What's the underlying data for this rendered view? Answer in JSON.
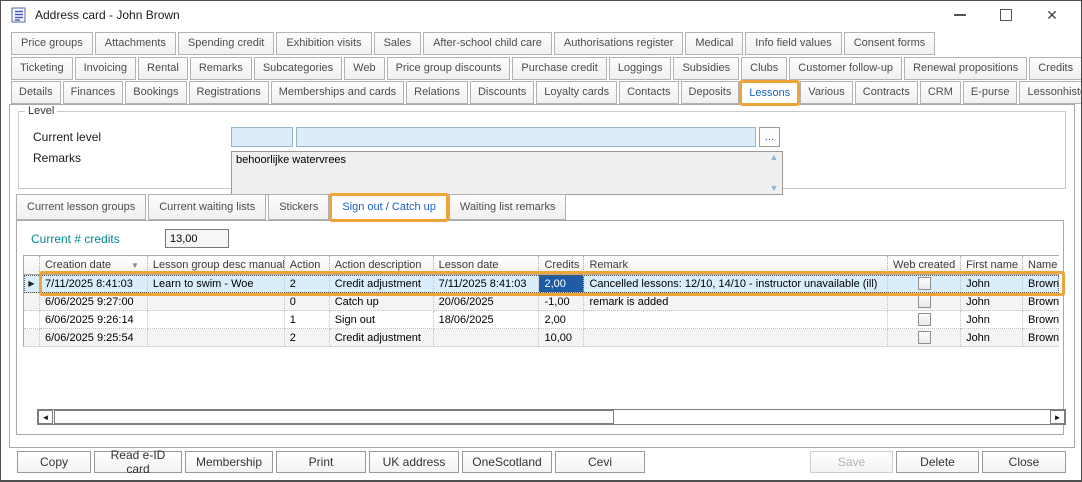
{
  "window": {
    "title": "Address card - John Brown"
  },
  "tabs_row1": [
    "Price groups",
    "Attachments",
    "Spending credit",
    "Exhibition visits",
    "Sales",
    "After-school child care",
    "Authorisations register",
    "Medical",
    "Info field values",
    "Consent forms"
  ],
  "tabs_row2": [
    "Ticketing",
    "Invoicing",
    "Rental",
    "Remarks",
    "Subcategories",
    "Web",
    "Price group discounts",
    "Purchase credit",
    "Loggings",
    "Subsidies",
    "Clubs",
    "Customer follow-up",
    "Renewal propositions",
    "Credits"
  ],
  "tabs_row3": [
    "Details",
    "Finances",
    "Bookings",
    "Registrations",
    "Memberships and cards",
    "Relations",
    "Discounts",
    "Loyalty cards",
    "Contacts",
    "Deposits",
    "Lessons",
    "Various",
    "Contracts",
    "CRM",
    "E-purse",
    "Lessonhistory"
  ],
  "selected_tab": "Lessons",
  "level": {
    "legend": "Level",
    "current_level_label": "Current level",
    "current_level_code": "",
    "current_level_desc": "",
    "browse_button": "...",
    "remarks_label": "Remarks",
    "remarks_value": "behoorlijke watervrees"
  },
  "subtabs": [
    "Current lesson groups",
    "Current waiting lists",
    "Stickers",
    "Sign out / Catch up",
    "Waiting list remarks"
  ],
  "selected_subtab": "Sign out / Catch up",
  "credits_panel": {
    "label": "Current # credits",
    "value": "13,00"
  },
  "grid": {
    "columns": [
      "Creation date",
      "Lesson group desc manual",
      "Action",
      "Action description",
      "Lesson date",
      "Credits",
      "Remark",
      "Web created",
      "First name",
      "Name"
    ],
    "sorted_column": "Creation date",
    "sort_direction": "desc",
    "rows": [
      [
        "7/11/2025 8:41:03",
        "Learn to swim - Woe",
        "2",
        "Credit adjustment",
        "7/11/2025 8:41:03",
        "2,00",
        "Cancelled lessons: 12/10, 14/10 - instructor unavailable (ill)",
        "",
        "John",
        "Brown"
      ],
      [
        "6/06/2025 9:27:00",
        "",
        "0",
        "Catch up",
        "20/06/2025",
        "-1,00",
        "remark is added",
        "",
        "John",
        "Brown"
      ],
      [
        "6/06/2025 9:26:14",
        "",
        "1",
        "Sign out",
        "18/06/2025",
        "2,00",
        "",
        "",
        "John",
        "Brown"
      ],
      [
        "6/06/2025 9:25:54",
        "",
        "2",
        "Credit adjustment",
        "",
        "10,00",
        "",
        "",
        "John",
        "Brown"
      ]
    ],
    "web_created_checked": [
      false,
      false,
      false,
      false
    ],
    "selected_row_index": 0,
    "selected_cell": "Credits"
  },
  "footer": {
    "left_buttons": [
      "Copy",
      "Read e-ID card",
      "Membership",
      "Print",
      "UK address",
      "OneScotland",
      "Cevi"
    ],
    "save": "Save",
    "delete": "Delete",
    "close": "Close"
  },
  "colors": {
    "annotation_orange": "#efa439",
    "selected_cell_blue": "#1e5ca6",
    "selected_row_blue": "#d9edfa",
    "accent_blue": "#1b61c0",
    "credits_label_teal": "#018b90"
  }
}
